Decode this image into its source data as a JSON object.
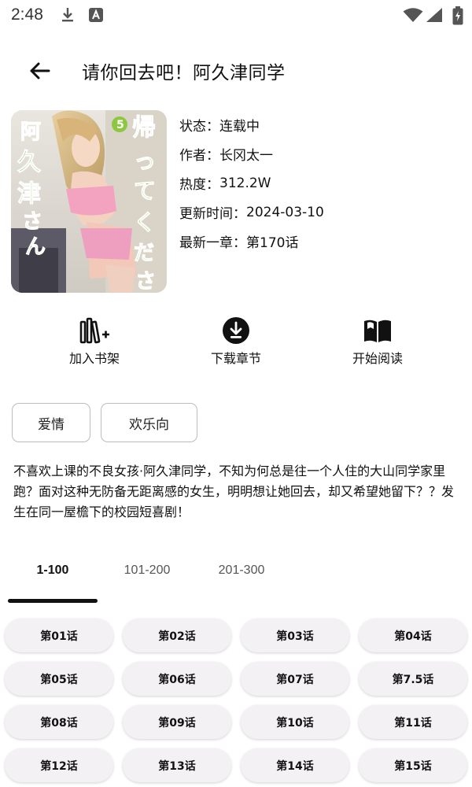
{
  "status_bar": {
    "time": "2:48",
    "icons": [
      "download-icon",
      "app-a-icon",
      "wifi-icon",
      "signal-icon",
      "battery-icon"
    ]
  },
  "header": {
    "title": "请你回去吧！阿久津同学"
  },
  "details": {
    "status_label": "状态：",
    "status_value": "连载中",
    "author_label": "作者：",
    "author_value": "长冈太一",
    "popularity_label": "热度：",
    "popularity_value": "312.2W",
    "updated_label": "更新时间：",
    "updated_value": "2024-03-10",
    "latest_label": "最新一章：",
    "latest_value": "第170话"
  },
  "cover": {
    "text_left": "阿久津さん",
    "text_right": "帰ってください!",
    "volume": "5"
  },
  "actions": [
    {
      "label": "加入书架",
      "icon": "bookshelf-add-icon"
    },
    {
      "label": "下载章节",
      "icon": "download-circle-icon"
    },
    {
      "label": "开始阅读",
      "icon": "open-book-icon"
    }
  ],
  "tags": [
    "爱情",
    "欢乐向"
  ],
  "description": "不喜欢上课的不良女孩·阿久津同学，不知为何总是往一个人住的大山同学家里跑？面对这种无防备无距离感的女生，明明想让她回去，却又希望她留下？？发生在同一屋檐下的校园短喜剧！",
  "range_tabs": {
    "items": [
      "1-100",
      "101-200",
      "201-300"
    ],
    "active_index": 0
  },
  "chapters": [
    "第01话",
    "第02话",
    "第03话",
    "第04话",
    "第05话",
    "第06话",
    "第07话",
    "第7.5话",
    "第08话",
    "第09话",
    "第10话",
    "第11话",
    "第12话",
    "第13话",
    "第14话",
    "第15话"
  ],
  "colors": {
    "text": "#111111",
    "chip_bg": "#f3f1f4",
    "tag_border": "#bdbdbd",
    "indicator": "#111111"
  }
}
